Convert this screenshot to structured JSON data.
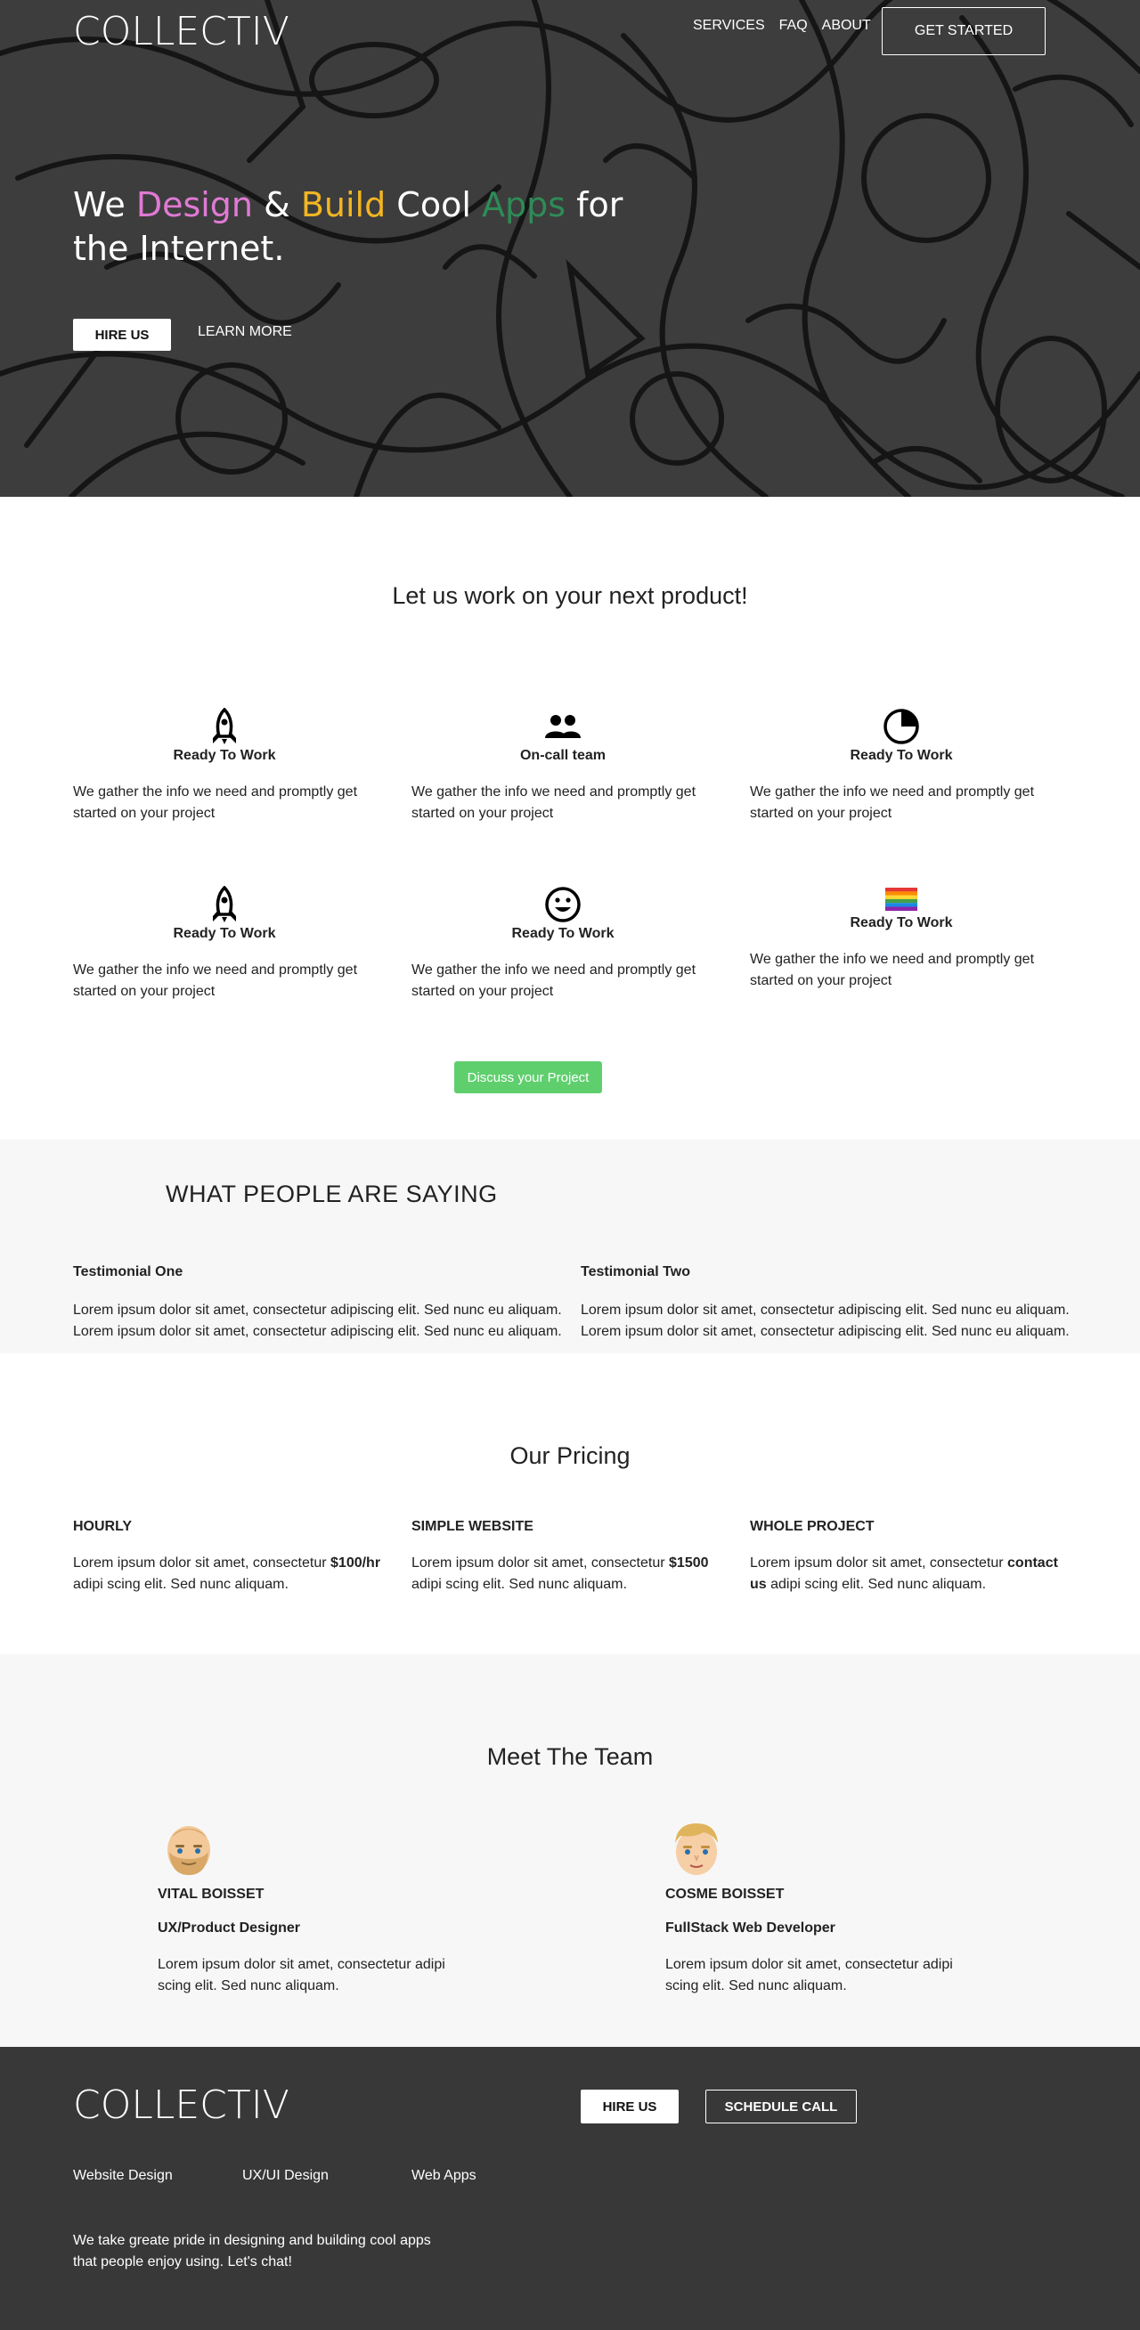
{
  "brand": {
    "logo": "COLLECTIV"
  },
  "nav": {
    "items": [
      "SERVICES",
      "FAQ",
      "ABOUT"
    ],
    "cta": "GET STARTED"
  },
  "hero": {
    "headline": {
      "w1": "We ",
      "w2": "Design",
      "w3": " & ",
      "w4": "Build",
      "w5": " Cool ",
      "w6": "Apps",
      "w7": " for the Internet."
    },
    "primary_button": "HIRE US",
    "secondary_button": "LEARN MORE",
    "colors": {
      "design": "#e07ad4",
      "build": "#f2b623",
      "apps": "#2e8b57"
    }
  },
  "services": {
    "title": "Let us work on your next product!",
    "items": [
      {
        "icon": "rocket-icon",
        "title": "Ready To Work",
        "text": "We gather the info we need and promptly get started on your project"
      },
      {
        "icon": "people-icon",
        "title": "On-call team",
        "text": "We gather the info we need and promptly get started on your project"
      },
      {
        "icon": "pie-chart-icon",
        "title": "Ready To Work",
        "text": "We gather the info we need and promptly get started on your project"
      },
      {
        "icon": "rocket-icon",
        "title": "Ready To Work",
        "text": "We gather the info we need and promptly get started on your project"
      },
      {
        "icon": "smiley-icon",
        "title": "Ready To Work",
        "text": "We gather the info we need and promptly get started on your project"
      },
      {
        "icon": "rainbow-flag-icon",
        "title": "Ready To Work",
        "text": "We gather the info we need and promptly get started on your project"
      }
    ],
    "cta": "Discuss your Project",
    "cta_color": "#5fcf6e"
  },
  "testimonials": {
    "title": "WHAT PEOPLE ARE SAYING",
    "items": [
      {
        "name": "Testimonial One",
        "text": "Lorem ipsum dolor sit amet, consectetur adipiscing elit. Sed nunc eu aliquam. Lorem ipsum dolor sit amet, consectetur adipiscing elit. Sed nunc eu aliquam."
      },
      {
        "name": "Testimonial Two",
        "text": "Lorem ipsum dolor sit amet, consectetur adipiscing elit. Sed nunc eu aliquam. Lorem ipsum dolor sit amet, consectetur adipiscing elit. Sed nunc eu aliquam."
      }
    ]
  },
  "pricing": {
    "title": "Our Pricing",
    "plans": [
      {
        "name": "HOURLY",
        "pre": "Lorem ipsum dolor sit amet, consectetur ",
        "price": "$100/hr",
        "post": " adipi scing elit. Sed nunc aliquam."
      },
      {
        "name": "SIMPLE WEBSITE",
        "pre": "Lorem ipsum dolor sit amet, consectetur ",
        "price": "$1500",
        "post": " adipi scing elit. Sed nunc aliquam."
      },
      {
        "name": "WHOLE PROJECT",
        "pre": "Lorem ipsum dolor sit amet, consectetur ",
        "price": "contact us",
        "post": " adipi scing elit. Sed nunc aliquam."
      }
    ]
  },
  "team": {
    "title": "Meet The Team",
    "members": [
      {
        "avatar": "bearded-man-avatar-icon",
        "name": "VITAL BOISSET",
        "role": "UX/Product Designer",
        "bio": "Lorem ipsum dolor sit amet, consectetur adipi scing elit. Sed nunc aliquam."
      },
      {
        "avatar": "blond-man-avatar-icon",
        "name": "COSME BOISSET",
        "role": "FullStack Web Developer",
        "bio": "Lorem ipsum dolor sit amet, consectetur adipi scing elit. Sed nunc aliquam."
      }
    ]
  },
  "footer": {
    "logo": "COLLECTIV",
    "hire_button": "HIRE US",
    "call_button": "SCHEDULE CALL",
    "links": [
      "Website Design",
      "UX/UI Design",
      "Web Apps"
    ],
    "text": "We take greate pride in designing and building cool apps that people enjoy using. Let's chat!"
  }
}
